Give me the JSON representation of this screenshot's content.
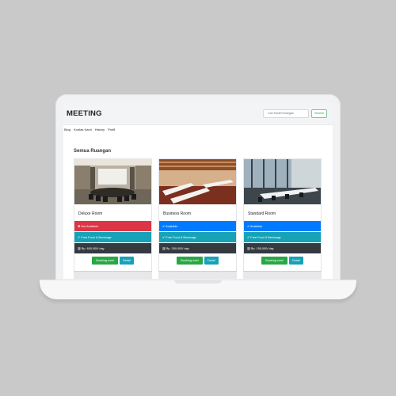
{
  "header": {
    "brand": "MEETING",
    "search_placeholder": "Cari Model Ruangan",
    "search_button": "Search"
  },
  "nav": [
    "Blog",
    "Kontak Kami",
    "History",
    "Profil"
  ],
  "section_title": "Semua Ruangan",
  "rooms": [
    {
      "name": "Deluxe Room",
      "availability": "Not Available",
      "availability_icon": "x-icon",
      "availability_color": "#dc3545",
      "amenity": "Free Food & Beverage",
      "price": "Rp. 600,000/ day",
      "book_label": "Booking now!",
      "detail_label": "Detail"
    },
    {
      "name": "Business Room",
      "availability": "Available",
      "availability_icon": "check-icon",
      "availability_color": "#007bff",
      "amenity": "Free Food & Beverage",
      "price": "Rp. 300,000/ day",
      "book_label": "Booking now!",
      "detail_label": "Detail"
    },
    {
      "name": "Standard Room",
      "availability": "Available",
      "availability_icon": "check-icon",
      "availability_color": "#007bff",
      "amenity": "Free Food & Beverage",
      "price": "Rp. 150,000/ day",
      "book_label": "Booking now!",
      "detail_label": "Detail"
    }
  ]
}
